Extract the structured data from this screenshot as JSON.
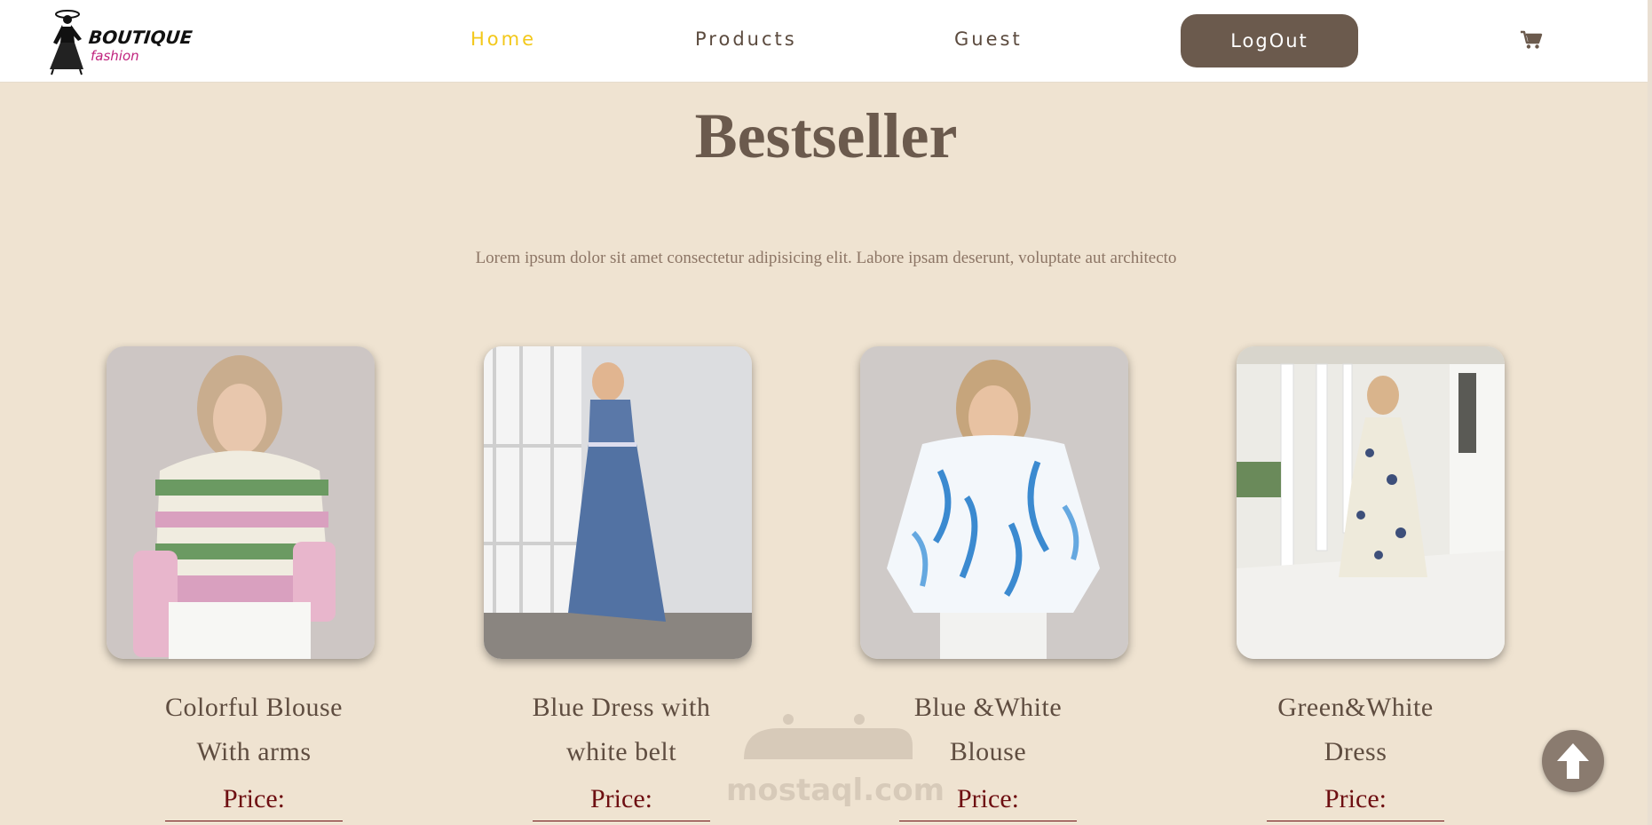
{
  "brand": {
    "line1": "BOUTIQUE",
    "line2": "fashion"
  },
  "nav": {
    "items": [
      {
        "label": "Home",
        "active": true
      },
      {
        "label": "Products",
        "active": false
      },
      {
        "label": "Guest",
        "active": false
      }
    ],
    "logout_label": "LogOut",
    "cart_icon": "cart-icon"
  },
  "section": {
    "title": "Bestseller",
    "subtitle": "Lorem ipsum dolor sit amet consectetur adipisicing elit. Labore ipsam deserunt, voluptate aut architecto"
  },
  "products": [
    {
      "name_line1": "Colorful Blouse",
      "name_line2": "With arms",
      "price_label": "Price:"
    },
    {
      "name_line1": "Blue Dress with",
      "name_line2": "white belt",
      "price_label": "Price:"
    },
    {
      "name_line1": "Blue &White",
      "name_line2": "Blouse",
      "price_label": "Price:"
    },
    {
      "name_line1": "Green&White",
      "name_line2": "Dress",
      "price_label": "Price:"
    }
  ],
  "watermark": {
    "latin": "mostaql.com"
  },
  "colors": {
    "background": "#efe3d1",
    "accent": "#6b5a4d",
    "active_link": "#f3c81a",
    "price": "#6e0f12"
  }
}
